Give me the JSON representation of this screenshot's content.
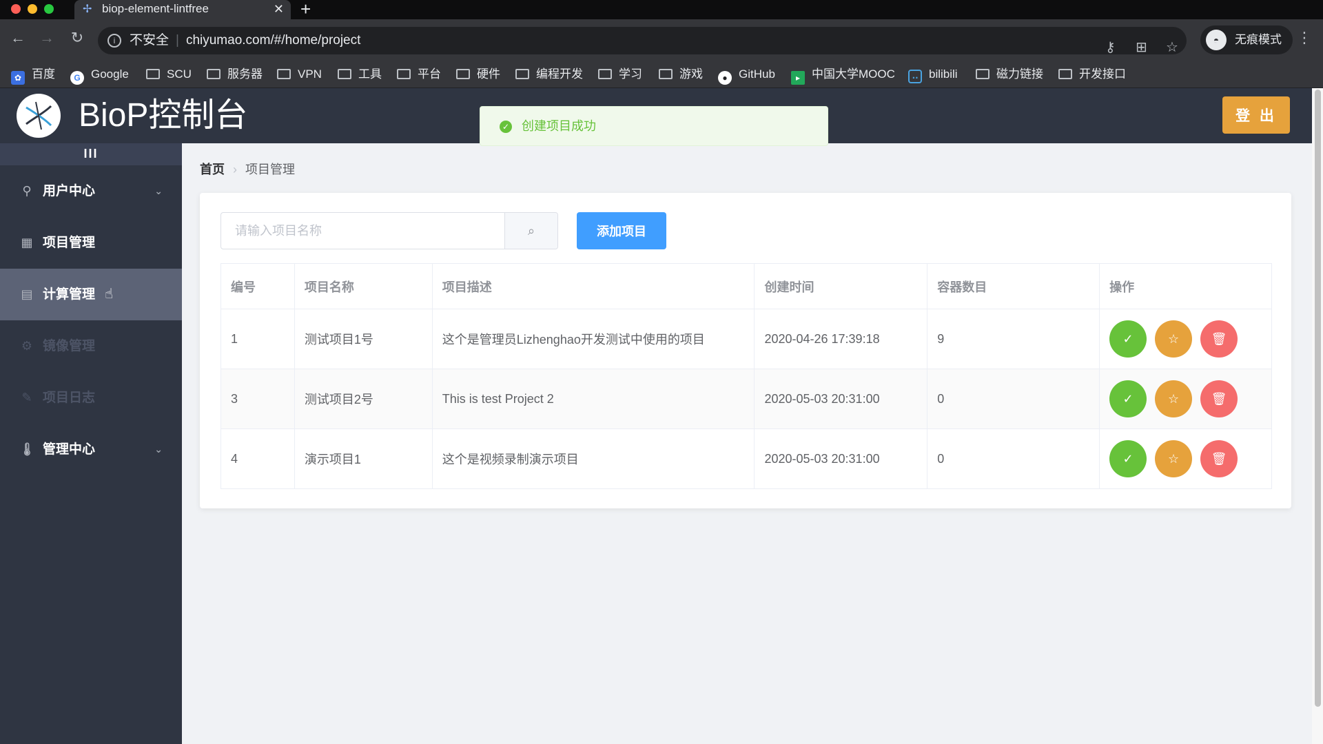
{
  "browser": {
    "tab_title": "biop-element-lintfree",
    "address": {
      "security_label": "不安全",
      "url": "chiyumao.com/#/home/project"
    },
    "profile_label": "无痕模式",
    "bookmarks": [
      "百度",
      "Google",
      "SCU",
      "服务器",
      "VPN",
      "工具",
      "平台",
      "硬件",
      "编程开发",
      "学习",
      "游戏",
      "GitHub",
      "中国大学MOOC",
      "bilibili",
      "磁力链接",
      "开发接口"
    ]
  },
  "app": {
    "title": "BioP控制台",
    "logout_label": "登 出",
    "toast": "创建项目成功"
  },
  "sidebar": {
    "collapse_label": "III",
    "items": [
      {
        "label": "用户中心",
        "icon": "location-pin-icon",
        "has_submenu": true
      },
      {
        "label": "项目管理",
        "icon": "grid-icon"
      },
      {
        "label": "计算管理",
        "icon": "document-icon",
        "active": true
      },
      {
        "label": "镜像管理",
        "icon": "gear-icon",
        "disabled": true
      },
      {
        "label": "项目日志",
        "icon": "pencil-icon",
        "disabled": true
      },
      {
        "label": "管理中心",
        "icon": "thermometer-icon",
        "has_submenu": true
      }
    ]
  },
  "breadcrumb": {
    "home": "首页",
    "current": "项目管理"
  },
  "search": {
    "placeholder": "请输入项目名称"
  },
  "toolbar": {
    "add_label": "添加项目"
  },
  "table": {
    "headers": [
      "编号",
      "项目名称",
      "项目描述",
      "创建时间",
      "容器数目",
      "操作"
    ],
    "rows": [
      {
        "id": "1",
        "name": "测试项目1号",
        "desc": "这个是管理员Lizhenghao开发测试中使用的项目",
        "created": "2020-04-26 17:39:18",
        "containers": "9"
      },
      {
        "id": "3",
        "name": "测试项目2号",
        "desc": "This is test Project 2",
        "created": "2020-05-03 20:31:00",
        "containers": "0"
      },
      {
        "id": "4",
        "name": "演示项目1",
        "desc": "这个是视频录制演示项目",
        "created": "2020-05-03 20:31:00",
        "containers": "0"
      }
    ]
  },
  "colors": {
    "primary": "#409eff",
    "success": "#67c23a",
    "warning": "#e6a23c",
    "danger": "#f56c6c",
    "sidebar": "#2f3542"
  }
}
